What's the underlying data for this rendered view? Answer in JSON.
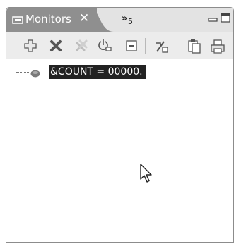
{
  "view": {
    "tab_label": "Monitors",
    "close_glyph": "✕",
    "overflow_chevron": "»",
    "overflow_count": "5"
  },
  "toolbar": {
    "icons": [
      "add-monitor-icon",
      "remove-monitor-icon",
      "remove-all-monitors-icon",
      "new-renderings-icon",
      "collapse-all-icon",
      "link-with-debug-view-icon",
      "copy-icon",
      "print-icon"
    ]
  },
  "tree": {
    "items": [
      {
        "label": "&COUNT = 00000."
      }
    ]
  },
  "colors": {
    "active_tab": "#8f8f8f",
    "tabbar": "#e3e3e3",
    "toolbar": "#ececec",
    "selection": "#222222"
  }
}
